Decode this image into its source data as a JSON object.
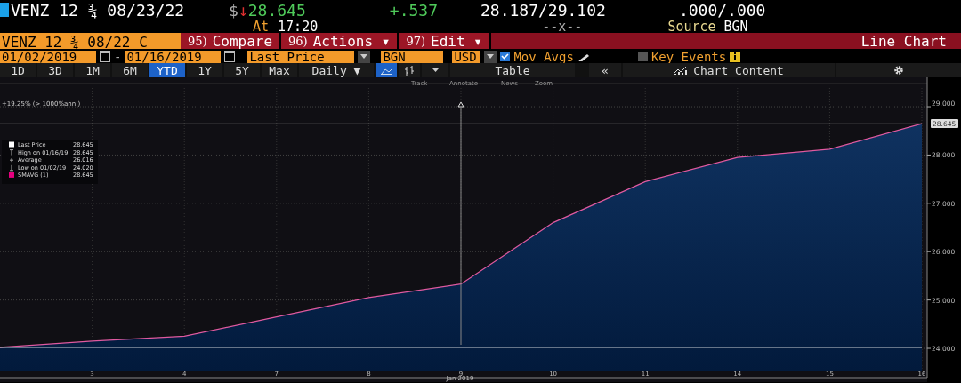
{
  "quote": {
    "ticker": "VENZ 12 ¾ 08/23/22",
    "currency": "$",
    "arrow": "↓",
    "price": "28.645",
    "change": "+.537",
    "bid_ask": "28.187/29.102",
    "bid_ask_size": ".000/.000",
    "time_label": "At",
    "time": "17:20",
    "size": "--x--",
    "source_label": "Source",
    "source": "BGN"
  },
  "command_bar": {
    "security": "VENZ 12 ¾ 08/22 C",
    "menus": [
      {
        "number": "95)",
        "label": "Compare"
      },
      {
        "number": "96)",
        "label": "Actions",
        "caret": "▾"
      },
      {
        "number": "97)",
        "label": "Edit",
        "caret": "▾"
      }
    ],
    "title": "Line Chart"
  },
  "settings": {
    "start_date": "01/02/2019",
    "end_date": "01/16/2019",
    "date_separator": "-",
    "field": "Last Price",
    "source": "BGN",
    "currency": "USD",
    "mov_avgs": {
      "label": "Mov Avgs",
      "checked": true
    },
    "key_events": {
      "label": "Key Events",
      "checked": false
    }
  },
  "ranges": [
    {
      "label": "1D",
      "selected": false
    },
    {
      "label": "3D",
      "selected": false
    },
    {
      "label": "1M",
      "selected": false
    },
    {
      "label": "6M",
      "selected": false
    },
    {
      "label": "YTD",
      "selected": true
    },
    {
      "label": "1Y",
      "selected": false
    },
    {
      "label": "5Y",
      "selected": false
    },
    {
      "label": "Max",
      "selected": false
    }
  ],
  "toolbar": {
    "frequency": "Daily",
    "frequency_caret": "▼",
    "chart_types": [
      {
        "kind": "line",
        "selected": true
      },
      {
        "kind": "bar",
        "selected": false
      }
    ],
    "table": "Table",
    "collapse": "«",
    "chart_content": "Chart Content"
  },
  "chart_tools": [
    "Track",
    "Annotate",
    "News",
    "Zoom"
  ],
  "chart": {
    "return_label": "+19.25% (> 1000%ann.)",
    "last_value_tag": "28.645",
    "legend": [
      {
        "kind": "swatch",
        "label": "Last Price",
        "value": "28.645",
        "color": "#ffffff"
      },
      {
        "kind": "high",
        "label": "High on 01/16/19",
        "value": "28.645"
      },
      {
        "kind": "average",
        "label": "Average",
        "value": "26.016"
      },
      {
        "kind": "low",
        "label": "Low on 01/02/19",
        "value": "24.020"
      },
      {
        "kind": "swatch",
        "label": "SMAVG (1)",
        "value": "28.645",
        "color": "#e6007e"
      }
    ],
    "chart_data": {
      "type": "area",
      "xlabel": "Jan 2019",
      "categories": [
        null,
        "3",
        "4",
        "7",
        "8",
        "9",
        "10",
        "11",
        "14",
        "15",
        "16"
      ],
      "series": [
        {
          "color": "#e05aa0",
          "values": [
            24.02,
            24.15,
            24.25,
            24.65,
            25.05,
            25.33,
            26.6,
            27.45,
            27.95,
            28.12,
            28.65
          ]
        }
      ],
      "ylim": [
        23.55,
        29.35
      ],
      "grid": true,
      "ref_lines": [
        {
          "axis": "y",
          "value": 28.645,
          "color": "#aaaaaa"
        },
        {
          "axis": "y",
          "value": 24.02,
          "color": "#eeeeee"
        },
        {
          "axis": "x",
          "value": "9",
          "color": "#888888"
        }
      ],
      "yticks": [
        {
          "value": 24,
          "label": "24.000"
        },
        {
          "value": 25,
          "label": "25.000"
        },
        {
          "value": 26,
          "label": "26.000"
        },
        {
          "value": 27,
          "label": "27.000"
        },
        {
          "value": 28,
          "label": "28.000"
        },
        {
          "value": 29,
          "label": "29.000"
        }
      ]
    }
  }
}
